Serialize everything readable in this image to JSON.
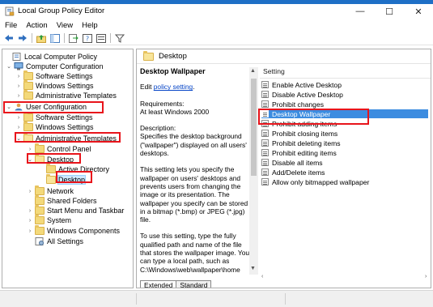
{
  "window": {
    "title": "Local Group Policy Editor",
    "icon": "group-policy-icon",
    "minimize": "—",
    "maximize": "☐",
    "close": "✕"
  },
  "menu": [
    "File",
    "Action",
    "View",
    "Help"
  ],
  "toolbar": [
    "back-arrow-icon",
    "forward-arrow-icon",
    "up-folder-icon",
    "show-tree-icon",
    "export-list-icon",
    "help-icon",
    "properties-icon",
    "filter-icon"
  ],
  "tree": {
    "root": "Local Computer Policy",
    "computer_config": "Computer Configuration",
    "cc_software": "Software Settings",
    "cc_windows": "Windows Settings",
    "cc_admin": "Administrative Templates",
    "user_config": "User Configuration",
    "uc_software": "Software Settings",
    "uc_windows": "Windows Settings",
    "uc_admin": "Administrative Templates",
    "control_panel": "Control Panel",
    "desktop": "Desktop",
    "active_directory": "Active Directory",
    "desktop_sub": "Desktop",
    "network": "Network",
    "shared_folders": "Shared Folders",
    "start_menu": "Start Menu and Taskbar",
    "system": "System",
    "windows_components": "Windows Components",
    "all_settings": "All Settings"
  },
  "right_header": "Desktop",
  "description": {
    "heading": "Desktop Wallpaper",
    "edit_prefix": "Edit",
    "edit_link": "policy setting",
    "edit_suffix": ".",
    "req_label": "Requirements:",
    "req_value": "At least Windows 2000",
    "desc_label": "Description:",
    "desc_text": "Specifies the desktop background (\"wallpaper\") displayed on all users' desktops.",
    "para2": "This setting lets you specify the wallpaper on users' desktops and prevents users from changing the image or its presentation. The wallpaper you specify can be stored in a bitmap (*.bmp) or JPEG (*.jpg) file.",
    "para3": "To use this setting, type the fully qualified path and name of the file that stores the wallpaper image. You can type a local path, such as C:\\Windows\\web\\wallpaper\\home"
  },
  "settings": {
    "column": "Setting",
    "items": [
      "Enable Active Desktop",
      "Disable Active Desktop",
      "Prohibit changes",
      "Desktop Wallpaper",
      "Prohibit adding items",
      "Prohibit closing items",
      "Prohibit deleting items",
      "Prohibit editing items",
      "Disable all items",
      "Add/Delete items",
      "Allow only bitmapped wallpaper"
    ]
  },
  "tabs": [
    "Extended",
    "Standard"
  ],
  "colors": {
    "highlight": "#e8141b",
    "selection": "#3c8ce0",
    "folder": "#f3d97a"
  }
}
